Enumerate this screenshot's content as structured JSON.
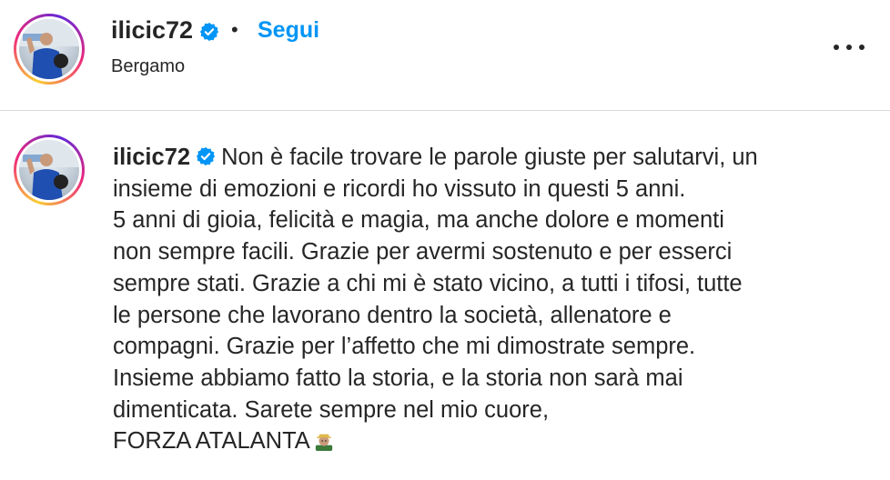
{
  "header": {
    "username": "ilicic72",
    "separator": "•",
    "follow_label": "Segui",
    "location": "Bergamo"
  },
  "icons": {
    "verified": "verified-badge-icon",
    "more": "more-options-icon",
    "emoji": "man-farmer-emoji-icon"
  },
  "colors": {
    "accent": "#0095f6",
    "text": "#262626",
    "divider": "#dbdbdb"
  },
  "caption": {
    "username": "ilicic72",
    "lines": [
      "Non è facile trovare le parole giuste per salutarvi, un",
      "insieme di emozioni e ricordi ho vissuto in questi 5 anni.",
      "5 anni di gioia, felicità e magia, ma anche dolore e momenti",
      "non sempre facili. Grazie per avermi sostenuto e per esserci",
      "sempre stati. Grazie a chi mi è stato vicino, a tutti i tifosi, tutte",
      "le persone che lavorano dentro la società, allenatore e",
      "compagni. Grazie per l’affetto che mi dimostrate sempre.",
      "Insieme abbiamo fatto la storia, e la storia non sarà mai",
      "dimenticata. Sarete sempre nel mio cuore,",
      "FORZA ATALANTA"
    ]
  }
}
